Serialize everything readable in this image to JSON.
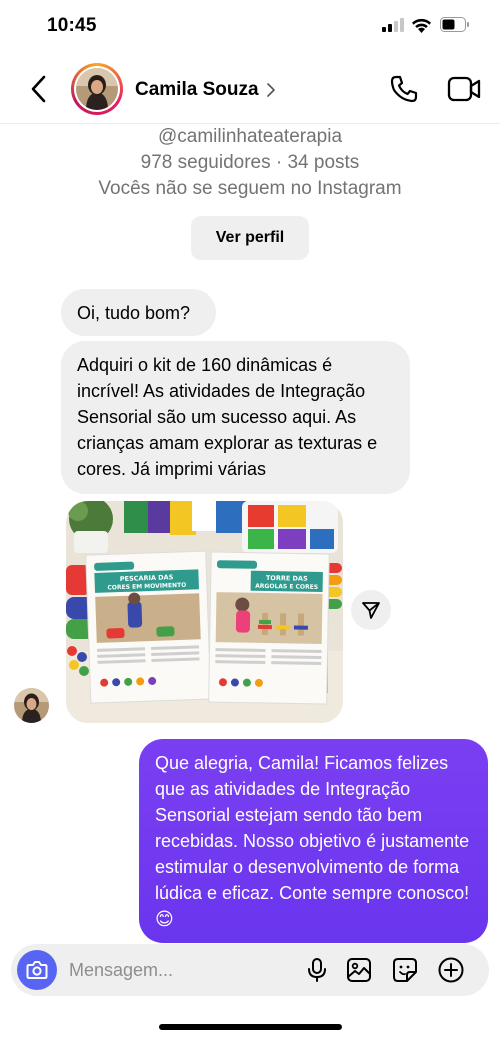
{
  "status_bar": {
    "time": "10:45"
  },
  "header": {
    "contact_name": "Camila Souza"
  },
  "profile": {
    "handle": "@camilinhateaterapia",
    "stats": "978 seguidores · 34 posts",
    "follow_status": "Vocês não se seguem no Instagram",
    "view_profile_label": "Ver perfil"
  },
  "messages": {
    "incoming_1": "Oi, tudo bom?",
    "incoming_2": "Adquiri o kit de 160 dinâmicas é incrível! As atividades de Integração Sensorial são um sucesso aqui. As crianças amam explorar as texturas e cores. Já imprimi várias",
    "photo": {
      "left_card_badge": "DINÂMICA 64",
      "left_card_title": "PESCARIA DAS CORES EM MOVIMENTO",
      "right_card_badge": "DINÂMICA 65",
      "right_card_title": "TORRE DAS ARGOLAS E CORES"
    },
    "outgoing_1": "Que alegria, Camila! Ficamos felizes que as atividades de Integração Sensorial estejam sendo tão bem recebidas. Nosso objetivo é justamente estimular o desenvolvimento de forma lúdica e eficaz. Conte sempre conosco! 😊"
  },
  "composer": {
    "placeholder": "Mensagem..."
  },
  "colors": {
    "accent": "#6a35ee",
    "camera": "#5865f2",
    "bubble_in": "#efefef"
  },
  "icons": [
    "back-arrow-icon",
    "chevron-right-icon",
    "phone-icon",
    "video-icon",
    "share-icon",
    "camera-icon",
    "mic-icon",
    "gallery-icon",
    "sticker-icon",
    "plus-icon"
  ]
}
